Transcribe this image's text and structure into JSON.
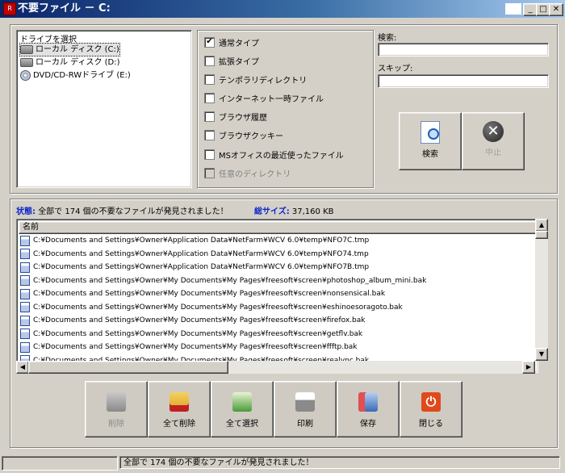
{
  "window": {
    "title": "不要ファイル － C:",
    "app_icon": "app-icon"
  },
  "drives": {
    "label": "ドライブを選択",
    "items": [
      {
        "label": "ローカル ディスク (C:)",
        "icon": "drive-icon",
        "selected": true
      },
      {
        "label": "ローカル ディスク (D:)",
        "icon": "drive-icon",
        "selected": false
      },
      {
        "label": "DVD/CD-RWドライブ (E:)",
        "icon": "dvd-icon",
        "selected": false
      }
    ]
  },
  "options": [
    {
      "label": "通常タイプ",
      "checked": true,
      "enabled": true
    },
    {
      "label": "拡張タイプ",
      "checked": false,
      "enabled": true
    },
    {
      "label": "テンポラリディレクトリ",
      "checked": false,
      "enabled": true
    },
    {
      "label": "インターネット一時ファイル",
      "checked": false,
      "enabled": true
    },
    {
      "label": "ブラウザ履歴",
      "checked": false,
      "enabled": true
    },
    {
      "label": "ブラウザクッキー",
      "checked": false,
      "enabled": true
    },
    {
      "label": "MSオフィスの最近使ったファイル",
      "checked": false,
      "enabled": true
    },
    {
      "label": "任意のディレクトリ",
      "checked": false,
      "enabled": false
    }
  ],
  "search": {
    "search_label": "検索:",
    "search_value": "",
    "skip_label": "スキップ:",
    "skip_value": "",
    "search_button": "検索",
    "stop_button": "中止"
  },
  "status": {
    "state_label": "状態:",
    "state_text": "全部で 174 個の不要なファイルが発見されました！",
    "size_label": "総サイズ:",
    "size_value": "37,160 KB"
  },
  "results": {
    "column_header": "名前",
    "rows": [
      "C:¥Documents and Settings¥Owner¥Application Data¥NetFarm¥WCV 6.0¥temp¥NFO7C.tmp",
      "C:¥Documents and Settings¥Owner¥Application Data¥NetFarm¥WCV 6.0¥temp¥NFO74.tmp",
      "C:¥Documents and Settings¥Owner¥Application Data¥NetFarm¥WCV 6.0¥temp¥NFO7B.tmp",
      "C:¥Documents and Settings¥Owner¥My Documents¥My Pages¥freesoft¥screen¥photoshop_album_mini.bak",
      "C:¥Documents and Settings¥Owner¥My Documents¥My Pages¥freesoft¥screen¥nonsensical.bak",
      "C:¥Documents and Settings¥Owner¥My Documents¥My Pages¥freesoft¥screen¥eshinoesoragoto.bak",
      "C:¥Documents and Settings¥Owner¥My Documents¥My Pages¥freesoft¥screen¥firefox.bak",
      "C:¥Documents and Settings¥Owner¥My Documents¥My Pages¥freesoft¥screen¥getflv.bak",
      "C:¥Documents and Settings¥Owner¥My Documents¥My Pages¥freesoft¥screen¥ffftp.bak",
      "C:¥Documents and Settings¥Owner¥My Documents¥My Pages¥freesoft¥screen¥realvnc.bak"
    ]
  },
  "actions": [
    {
      "label": "削除",
      "icon": "delete-icon",
      "enabled": false,
      "color": "#9a9a9a"
    },
    {
      "label": "全て削除",
      "icon": "delete-all-icon",
      "enabled": true,
      "color": "#d9a020"
    },
    {
      "label": "全て選択",
      "icon": "select-all-icon",
      "enabled": true,
      "color": "#4a9a3a"
    },
    {
      "label": "印刷",
      "icon": "print-icon",
      "enabled": true,
      "color": "#8a8a8a"
    },
    {
      "label": "保存",
      "icon": "save-icon",
      "enabled": true,
      "color": "#3a6ab8"
    },
    {
      "label": "閉じる",
      "icon": "close-app-icon",
      "enabled": true,
      "color": "#e04a1a"
    }
  ],
  "statusbar": {
    "message": "全部で 174 個の不要なファイルが発見されました！"
  }
}
